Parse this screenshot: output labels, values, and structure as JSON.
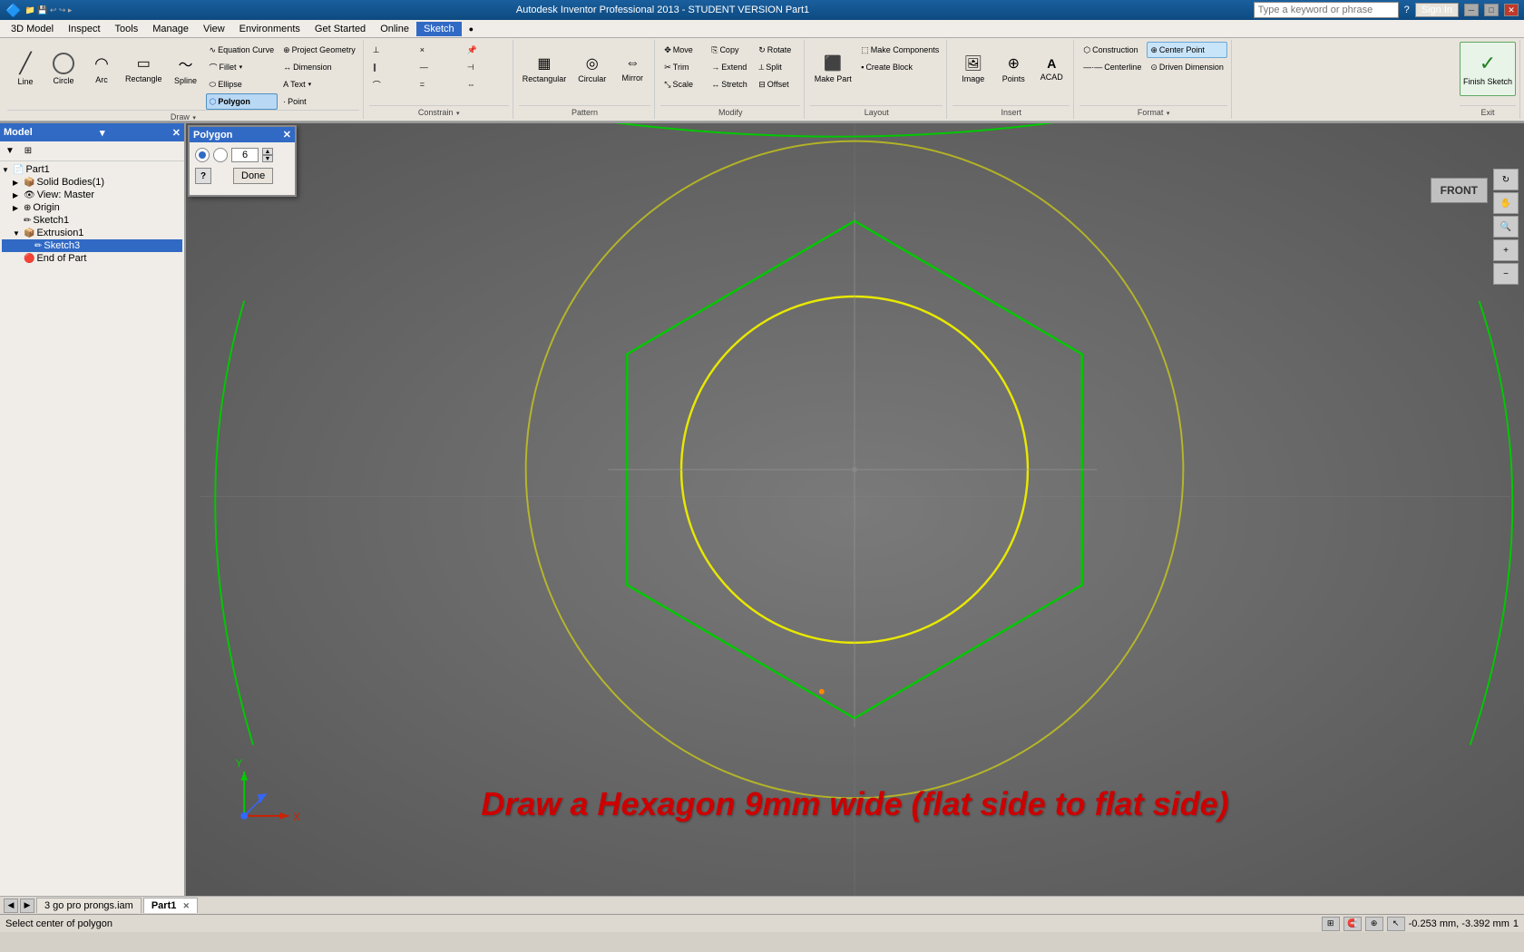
{
  "app": {
    "title": "Autodesk Inventor Professional 2013 - STUDENT VERSION   Part1",
    "search_placeholder": "Type a keyword or phrase"
  },
  "titlebar": {
    "close": "✕",
    "minimize": "─",
    "maximize": "□",
    "restore": "❐"
  },
  "menus": {
    "items": [
      "3D Model",
      "Inspect",
      "Tools",
      "Manage",
      "View",
      "Environments",
      "Get Started",
      "Online",
      "Sketch",
      "●"
    ]
  },
  "ribbon": {
    "tabs": [
      "Sketch"
    ],
    "groups": {
      "draw": {
        "title": "Draw",
        "buttons": [
          {
            "id": "line",
            "label": "Line",
            "icon": "/"
          },
          {
            "id": "circle",
            "label": "Circle",
            "icon": "○"
          },
          {
            "id": "arc",
            "label": "Arc",
            "icon": "◠"
          },
          {
            "id": "rectangle",
            "label": "Rectangle",
            "icon": "▭"
          },
          {
            "id": "spline",
            "label": "Spline",
            "icon": "~"
          }
        ],
        "small_buttons": [
          {
            "id": "equation-curve",
            "label": "Equation Curve",
            "icon": "∿"
          },
          {
            "id": "fillet",
            "label": "Fillet",
            "icon": "⌒"
          },
          {
            "id": "ellipse",
            "label": "Ellipse",
            "icon": "⬭"
          },
          {
            "id": "polygon",
            "label": "Polygon",
            "icon": "⬡",
            "active": true
          },
          {
            "id": "project-geometry",
            "label": "Project Geometry",
            "icon": "⊕"
          },
          {
            "id": "text",
            "label": "Text",
            "icon": "A"
          },
          {
            "id": "point",
            "label": "Point",
            "icon": "·"
          }
        ]
      },
      "constrain": {
        "title": "Constrain",
        "buttons": []
      },
      "pattern": {
        "title": "Pattern",
        "buttons": [
          {
            "id": "rectangular",
            "label": "Rectangular",
            "icon": "▦"
          },
          {
            "id": "circular",
            "label": "Circular",
            "icon": "◎"
          },
          {
            "id": "mirror",
            "label": "Mirror",
            "icon": "⇔"
          }
        ]
      },
      "modify": {
        "title": "Modify",
        "buttons": [
          {
            "id": "move",
            "label": "Move",
            "icon": "✥"
          },
          {
            "id": "trim",
            "label": "Trim",
            "icon": "✂"
          },
          {
            "id": "scale",
            "label": "Scale",
            "icon": "⤡"
          },
          {
            "id": "copy",
            "label": "Copy",
            "icon": "⎘"
          },
          {
            "id": "extend",
            "label": "Extend",
            "icon": "→"
          },
          {
            "id": "stretch",
            "label": "Stretch",
            "icon": "↔"
          },
          {
            "id": "rotate",
            "label": "Rotate",
            "icon": "↻"
          },
          {
            "id": "split",
            "label": "Split",
            "icon": "⚟"
          },
          {
            "id": "offset",
            "label": "Offset",
            "icon": "⊟"
          }
        ]
      },
      "layout": {
        "title": "Layout",
        "buttons": [
          {
            "id": "make-part",
            "label": "Make Part",
            "icon": "⬛"
          },
          {
            "id": "make-components",
            "label": "Make Components",
            "icon": "⬚"
          },
          {
            "id": "create-block",
            "label": "Create Block",
            "icon": "▪"
          }
        ]
      },
      "insert": {
        "title": "Insert",
        "buttons": [
          {
            "id": "image",
            "label": "Image",
            "icon": "🖼"
          },
          {
            "id": "points",
            "label": "Points",
            "icon": "⊕"
          },
          {
            "id": "acad",
            "label": "ACAD",
            "icon": "A"
          }
        ]
      },
      "format": {
        "title": "Format",
        "buttons": [
          {
            "id": "construction",
            "label": "Construction",
            "icon": "⬡"
          },
          {
            "id": "centerline",
            "label": "Centerline",
            "icon": "---"
          },
          {
            "id": "center-point",
            "label": "Center Point",
            "icon": "⊕"
          },
          {
            "id": "driven-dimension",
            "label": "Driven Dimension",
            "icon": "⊙"
          }
        ]
      },
      "exit": {
        "title": "Exit",
        "buttons": [
          {
            "id": "finish-sketch",
            "label": "Finish Sketch",
            "icon": "✓"
          }
        ]
      }
    }
  },
  "polygon_dialog": {
    "title": "Polygon",
    "sides_value": "6",
    "done_label": "Done",
    "close": "✕"
  },
  "model_panel": {
    "title": "Model",
    "tree_items": [
      {
        "id": "part1",
        "label": "Part1",
        "level": 0,
        "expanded": true,
        "icon": "📄"
      },
      {
        "id": "solid-bodies",
        "label": "Solid Bodies(1)",
        "level": 1,
        "expanded": false,
        "icon": "📦"
      },
      {
        "id": "view-master",
        "label": "View: Master",
        "level": 1,
        "expanded": false,
        "icon": "👁"
      },
      {
        "id": "origin",
        "label": "Origin",
        "level": 1,
        "expanded": false,
        "icon": "⊕"
      },
      {
        "id": "sketch1",
        "label": "Sketch1",
        "level": 1,
        "expanded": false,
        "icon": "✏"
      },
      {
        "id": "extrusion1",
        "label": "Extrusion1",
        "level": 1,
        "expanded": true,
        "icon": "📦"
      },
      {
        "id": "sketch3",
        "label": "Sketch3",
        "level": 2,
        "expanded": false,
        "icon": "✏"
      },
      {
        "id": "end-of-part",
        "label": "End of Part",
        "level": 1,
        "expanded": false,
        "icon": "🔴"
      }
    ]
  },
  "viewport": {
    "front_label": "FRONT"
  },
  "instruction": {
    "text": "Draw a Hexagon 9mm wide (flat side to flat side)"
  },
  "statusbar": {
    "left": "Select center of polygon",
    "coords": "-0.253 mm, -3.392 mm",
    "page": "1"
  },
  "tabbar": {
    "tabs": [
      {
        "id": "assembly",
        "label": "3 go pro prongs.iam",
        "active": false,
        "closeable": false
      },
      {
        "id": "part1",
        "label": "Part1",
        "active": true,
        "closeable": true
      }
    ]
  },
  "colors": {
    "accent": "#316ac5",
    "toolbar_bg": "#e8e4dc",
    "viewport_bg": "#6b6b6b",
    "geometry_yellow": "#e8e800",
    "geometry_green": "#00c800",
    "dialog_header": "#316ac5"
  }
}
